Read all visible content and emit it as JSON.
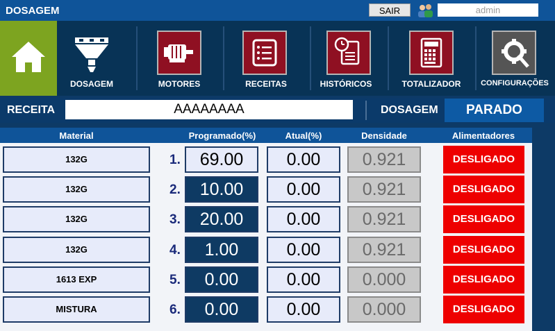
{
  "header": {
    "title": "DOSAGEM",
    "logout_label": "SAIR",
    "user": "admin"
  },
  "nav": {
    "items": [
      {
        "label": "DOSAGEM",
        "icon": "hopper-icon"
      },
      {
        "label": "MOTORES",
        "icon": "motor-icon"
      },
      {
        "label": "RECEITAS",
        "icon": "recipe-list-icon"
      },
      {
        "label": "HISTÓRICOS",
        "icon": "history-icon"
      },
      {
        "label": "TOTALIZADOR",
        "icon": "calculator-icon"
      },
      {
        "label": "CONFIGURAÇÕES",
        "icon": "settings-icon"
      }
    ]
  },
  "receita": {
    "label": "RECEITA",
    "value": "AAAAAAAA"
  },
  "dosagem": {
    "label": "DOSAGEM",
    "status": "PARADO"
  },
  "table": {
    "columns": [
      "Material",
      "Programado(%)",
      "Atual(%)",
      "Densidade",
      "Alimentadores"
    ],
    "rows": [
      {
        "num": "1.",
        "material": "132G",
        "programado": "69.00",
        "atual": "0.00",
        "densidade": "0.921",
        "alimentador": "DESLIGADO"
      },
      {
        "num": "2.",
        "material": "132G",
        "programado": "10.00",
        "atual": "0.00",
        "densidade": "0.921",
        "alimentador": "DESLIGADO"
      },
      {
        "num": "3.",
        "material": "132G",
        "programado": "20.00",
        "atual": "0.00",
        "densidade": "0.921",
        "alimentador": "DESLIGADO"
      },
      {
        "num": "4.",
        "material": "132G",
        "programado": "1.00",
        "atual": "0.00",
        "densidade": "0.921",
        "alimentador": "DESLIGADO"
      },
      {
        "num": "5.",
        "material": "1613 EXP",
        "programado": "0.00",
        "atual": "0.00",
        "densidade": "0.000",
        "alimentador": "DESLIGADO"
      },
      {
        "num": "6.",
        "material": "MISTURA",
        "programado": "0.00",
        "atual": "0.00",
        "densidade": "0.000",
        "alimentador": "DESLIGADO"
      }
    ]
  },
  "colors": {
    "accent": "#0f5499",
    "home": "#7da420",
    "off": "#ee0000",
    "icon_red": "#8f1022"
  }
}
